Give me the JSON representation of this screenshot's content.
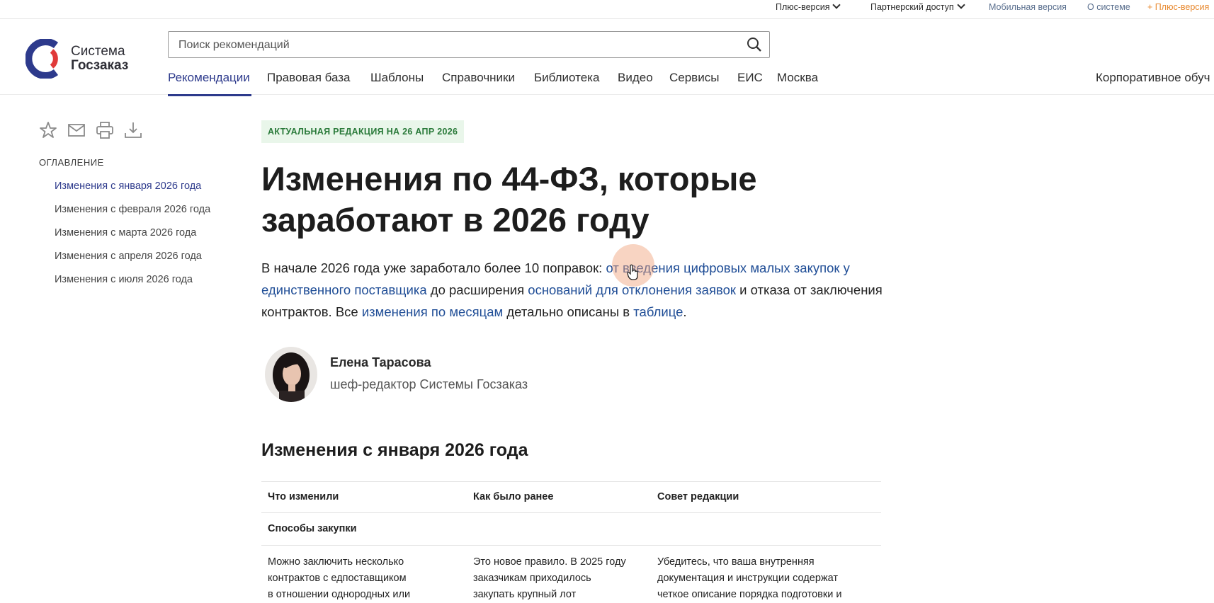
{
  "topbar": {
    "plus_version": "Плюс-версия",
    "partner_access": "Партнерский доступ",
    "mobile_version": "Мобильная версия",
    "about": "О системе",
    "plus_version_promo": "Плюс-версия"
  },
  "logo": {
    "line1": "Система",
    "line2": "Госзаказ",
    "colors": {
      "blue": "#2d3a8c",
      "red": "#e03a3a"
    }
  },
  "search": {
    "placeholder": "Поиск рекомендаций"
  },
  "nav": {
    "items": [
      "Рекомендации",
      "Правовая база",
      "Шаблоны",
      "Справочники",
      "Библиотека",
      "Видео",
      "Сервисы",
      "ЕИС",
      "Москва"
    ],
    "active": "Рекомендации",
    "corporate": "Корпоративное обуч"
  },
  "toolbar_icons": [
    "star-icon",
    "mail-icon",
    "print-icon",
    "download-icon"
  ],
  "toc": {
    "title": "ОГЛАВЛЕНИЕ",
    "items": [
      "Изменения с января 2026 года",
      "Изменения с февраля 2026 года",
      "Изменения с марта 2026 года",
      "Изменения с апреля 2026 года",
      "Изменения с июля 2026 года"
    ]
  },
  "article": {
    "badge": "АКТУАЛЬНАЯ РЕДАКЦИЯ НА 26 АПР 2026",
    "title": "Изменения по 44-ФЗ, которые заработают в 2026 году",
    "lead": {
      "t1": "В начале 2026 года уже заработало более 10 поправок: ",
      "l1": "от введения цифровых малых закупок у единственного поставщика",
      "t2": " до расширения ",
      "l2": "оснований для отклонения заявок",
      "t3": " и отказа от заключения контрактов. Все ",
      "l3": "изменения по месяцам",
      "t4": " детально описаны в ",
      "l4": "таблице",
      "t5": "."
    },
    "author": {
      "name": "Елена Тарасова",
      "role": "шеф-редактор Системы Госзаказ"
    },
    "section_title": "Изменения с января 2026 года",
    "table": {
      "headers": [
        "Что изменили",
        "Как было ранее",
        "Совет редакции"
      ],
      "group": "Способы закупки",
      "row1": {
        "c1": [
          "Можно заключить несколько",
          "контрактов с едпоставщиком",
          "в отношении однородных или"
        ],
        "c2": [
          "Это новое правило. В 2025 году",
          "заказчикам приходилось",
          "закупать крупный лот"
        ],
        "c3": [
          "Убедитесь, что ваша внутренняя",
          "документация и инструкции содержат",
          "четкое описание порядка подготовки и"
        ]
      }
    }
  }
}
